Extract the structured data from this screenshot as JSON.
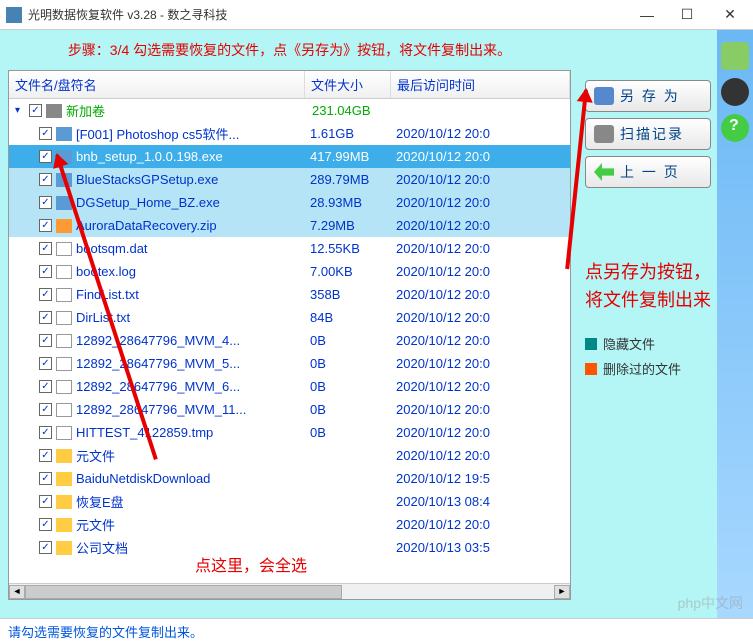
{
  "titlebar": {
    "title": "光明数据恢复软件 v3.28 - 数之寻科技"
  },
  "step_instruction": "步骤：3/4 勾选需要恢复的文件，点《另存为》按钮，将文件复制出来。",
  "columns": {
    "name": "文件名/盘符名",
    "size": "文件大小",
    "time": "最后访问时间"
  },
  "root": {
    "name": "新加卷",
    "size": "231.04GB",
    "time": ""
  },
  "files": [
    {
      "name": "[F001] Photoshop cs5软件...",
      "size": "1.61GB",
      "time": "2020/10/12 20:0",
      "icon": "app",
      "sel": false
    },
    {
      "name": "bnb_setup_1.0.0.198.exe",
      "size": "417.99MB",
      "time": "2020/10/12 20:0",
      "icon": "app",
      "sel": true
    },
    {
      "name": "BlueStacksGPSetup.exe",
      "size": "289.79MB",
      "time": "2020/10/12 20:0",
      "icon": "app",
      "sel": false,
      "hl": true
    },
    {
      "name": "DGSetup_Home_BZ.exe",
      "size": "28.93MB",
      "time": "2020/10/12 20:0",
      "icon": "app",
      "sel": false,
      "hl": true
    },
    {
      "name": "AuroraDataRecovery.zip",
      "size": "7.29MB",
      "time": "2020/10/12 20:0",
      "icon": "zip",
      "sel": false,
      "hl": true
    },
    {
      "name": "bootsqm.dat",
      "size": "12.55KB",
      "time": "2020/10/12 20:0",
      "icon": "file",
      "sel": false
    },
    {
      "name": "bootex.log",
      "size": "7.00KB",
      "time": "2020/10/12 20:0",
      "icon": "file",
      "sel": false
    },
    {
      "name": "FindList.txt",
      "size": "358B",
      "time": "2020/10/12 20:0",
      "icon": "file",
      "sel": false
    },
    {
      "name": "DirList.txt",
      "size": "84B",
      "time": "2020/10/12 20:0",
      "icon": "file",
      "sel": false
    },
    {
      "name": "12892_28647796_MVM_4...",
      "size": "0B",
      "time": "2020/10/12 20:0",
      "icon": "file",
      "sel": false
    },
    {
      "name": "12892_28647796_MVM_5...",
      "size": "0B",
      "time": "2020/10/12 20:0",
      "icon": "file",
      "sel": false
    },
    {
      "name": "12892_28647796_MVM_6...",
      "size": "0B",
      "time": "2020/10/12 20:0",
      "icon": "file",
      "sel": false
    },
    {
      "name": "12892_28647796_MVM_11...",
      "size": "0B",
      "time": "2020/10/12 20:0",
      "icon": "file",
      "sel": false
    },
    {
      "name": "HITTEST_4122859.tmp",
      "size": "0B",
      "time": "2020/10/12 20:0",
      "icon": "file",
      "sel": false
    },
    {
      "name": "元文件",
      "size": "",
      "time": "2020/10/12 20:0",
      "icon": "folder",
      "sel": false
    },
    {
      "name": "BaiduNetdiskDownload",
      "size": "",
      "time": "2020/10/12 19:5",
      "icon": "folder",
      "sel": false
    },
    {
      "name": "恢复E盘",
      "size": "",
      "time": "2020/10/13 08:4",
      "icon": "folder",
      "sel": false
    },
    {
      "name": "元文件",
      "size": "",
      "time": "2020/10/12 20:0",
      "icon": "folder",
      "sel": false
    },
    {
      "name": "公司文档",
      "size": "",
      "time": "2020/10/13 03:5",
      "icon": "folder",
      "sel": false
    }
  ],
  "side_buttons": {
    "save_as": "另 存 为",
    "scan_log": "扫描记录",
    "prev_page": "上 一 页"
  },
  "callouts": {
    "c1": "点另存为按钮，将文件复制出来",
    "c2": "点这里，会全选"
  },
  "legend": {
    "hidden": "隐藏文件",
    "deleted": "删除过的文件"
  },
  "statusbar": "请勾选需要恢复的文件复制出来。",
  "watermark": "php中文网"
}
